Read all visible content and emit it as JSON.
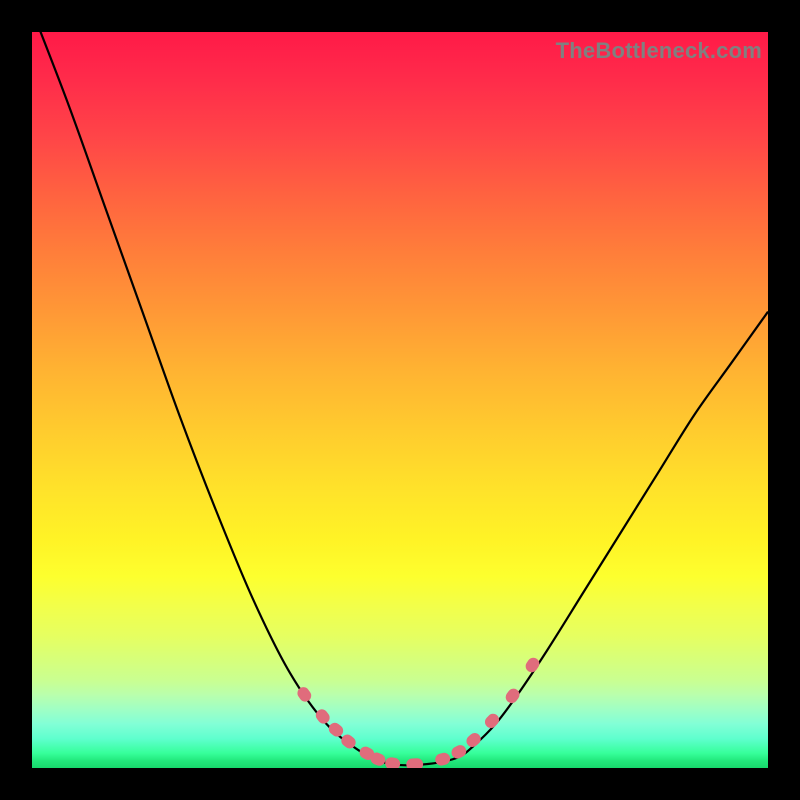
{
  "watermark": "TheBottleneck.com",
  "colors": {
    "frame": "#000000",
    "watermark": "#808080",
    "curve": "#000000",
    "marker": "#e06c7c",
    "gradient_top": "#ff1a48",
    "gradient_bottom": "#18d86c"
  },
  "chart_data": {
    "type": "line",
    "title": "",
    "xlabel": "",
    "ylabel": "",
    "xlim": [
      0,
      100
    ],
    "ylim": [
      0,
      100
    ],
    "x": [
      0,
      5,
      10,
      15,
      20,
      25,
      30,
      35,
      40,
      45,
      48,
      50,
      52,
      55,
      58,
      60,
      63,
      66,
      70,
      75,
      80,
      85,
      90,
      95,
      100
    ],
    "y": [
      103,
      90,
      76,
      62,
      48,
      35,
      23,
      13,
      6,
      2,
      0.7,
      0.4,
      0.4,
      0.7,
      1.5,
      3,
      6,
      10,
      16,
      24,
      32,
      40,
      48,
      55,
      62
    ],
    "note": "y is percentage height from bottom; curve is a V-shaped bottleneck plot with minimum near x≈51",
    "markers": [
      {
        "x": 37.0,
        "y": 10.0,
        "len": 3.0
      },
      {
        "x": 39.5,
        "y": 7.0,
        "len": 3.0
      },
      {
        "x": 41.3,
        "y": 5.2,
        "len": 2.2
      },
      {
        "x": 43.0,
        "y": 3.6,
        "len": 2.5
      },
      {
        "x": 45.5,
        "y": 2.0,
        "len": 2.0
      },
      {
        "x": 47.0,
        "y": 1.2,
        "len": 2.0
      },
      {
        "x": 49.0,
        "y": 0.6,
        "len": 2.0
      },
      {
        "x": 52.0,
        "y": 0.5,
        "len": 4.0
      },
      {
        "x": 55.8,
        "y": 1.2,
        "len": 2.0
      },
      {
        "x": 58.0,
        "y": 2.2,
        "len": 2.2
      },
      {
        "x": 60.0,
        "y": 3.8,
        "len": 2.2
      },
      {
        "x": 62.5,
        "y": 6.4,
        "len": 3.2
      },
      {
        "x": 65.3,
        "y": 9.8,
        "len": 2.0
      },
      {
        "x": 68.0,
        "y": 14.0,
        "len": 3.5
      }
    ]
  }
}
